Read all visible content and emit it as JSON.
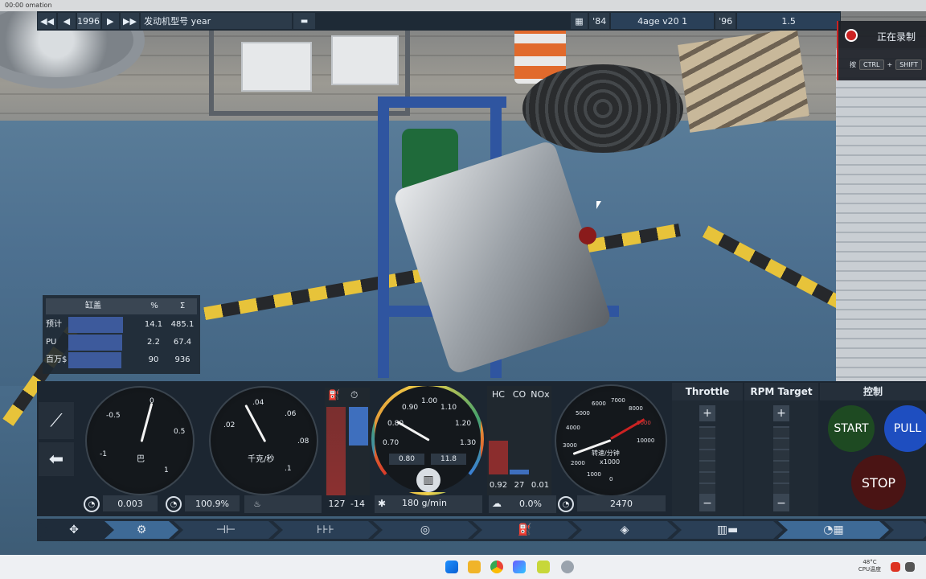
{
  "app": {
    "title": "omation",
    "timer": "00:00"
  },
  "topbar": {
    "year": "1996",
    "field_label": "发动机型号 year",
    "model_year_start": "'84",
    "engine_name": "4age v20 1",
    "model_year_end": "'96",
    "displacement": "1.5"
  },
  "recording": {
    "label": "正在录制",
    "hint_prefix": "按",
    "key1": "CTRL",
    "plus": "+",
    "key2": "SHIFT"
  },
  "cylinder_table": {
    "headers": [
      "缸盖",
      "%",
      "Σ"
    ],
    "rows": [
      {
        "label": "预计",
        "pct": "14.1",
        "sum": "485.1",
        "fill": 0.95
      },
      {
        "label": "PU",
        "pct": "2.2",
        "sum": "67.4",
        "fill": 0.97
      },
      {
        "label": "百万$",
        "pct": "90",
        "sum": "936",
        "fill": 0.93
      }
    ]
  },
  "gauges": {
    "boost": {
      "ticks": [
        "-0.5",
        "0",
        "0.5",
        "1",
        "-1"
      ],
      "unit": "巴",
      "value": "0.003",
      "efficiency": "100.9%"
    },
    "airflow": {
      "ticks": [
        ".04",
        ".06",
        ".08",
        ".1",
        ".02"
      ],
      "unit": "千克/秒"
    },
    "fuel_bars": {
      "left_value": "127",
      "right_value": "-14"
    },
    "afr": {
      "ticks": [
        "0.90",
        "1.00",
        "1.10",
        "1.20",
        "1.30",
        "0.80",
        "0.70"
      ],
      "sub1": "0.80",
      "sub2": "11.8",
      "fuel_flow": "180 g/min"
    },
    "emissions": {
      "labels": [
        "HC",
        "CO",
        "NOx"
      ],
      "values": [
        "0.92",
        "27",
        "0.01"
      ],
      "pct": "0.0%"
    },
    "rpm": {
      "ticks": [
        "6000",
        "7000",
        "5000",
        "8000",
        "4000",
        "9000",
        "3000",
        "10000",
        "2000",
        "1000",
        "0"
      ],
      "unit1": "转速/分钟",
      "unit2": "x1000",
      "value": "2470"
    }
  },
  "controls": {
    "throttle": "Throttle",
    "rpm_target": "RPM Target",
    "control": "控制",
    "start": "START",
    "pull": "PULL",
    "stop": "STOP",
    "plus": "+",
    "minus": "−"
  },
  "taskbar": {
    "temp": "48°C",
    "cpu": "CPU温度"
  }
}
